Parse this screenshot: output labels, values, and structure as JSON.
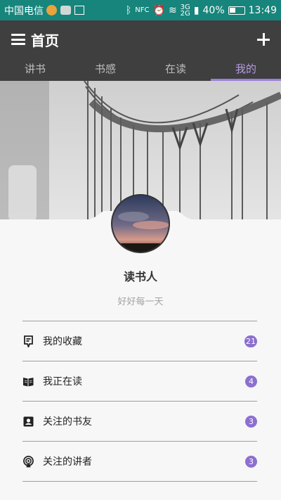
{
  "status_bar": {
    "carrier": "中国电信",
    "network": "3G",
    "network2": "2G",
    "battery_text": "40%",
    "battery_level": 0.4,
    "time": "13:49",
    "nfc_label": "NFC"
  },
  "header": {
    "title": "首页"
  },
  "tabs": [
    {
      "label": "讲书",
      "active": false
    },
    {
      "label": "书感",
      "active": false
    },
    {
      "label": "在读",
      "active": false
    },
    {
      "label": "我的",
      "active": true
    }
  ],
  "profile": {
    "name": "读书人",
    "motto": "好好每一天"
  },
  "menu": [
    {
      "label": "我的收藏",
      "count": "21",
      "icon": "bookmark-icon"
    },
    {
      "label": "我正在读",
      "count": "4",
      "icon": "open-book-icon"
    },
    {
      "label": "关注的书友",
      "count": "3",
      "icon": "contact-card-icon"
    },
    {
      "label": "关注的讲者",
      "count": "3",
      "icon": "podcast-icon"
    }
  ],
  "colors": {
    "status_bar": "#17857c",
    "toolbar": "#3f3f3f",
    "accent": "#9c7fd9",
    "badge": "#8c6fd0"
  }
}
